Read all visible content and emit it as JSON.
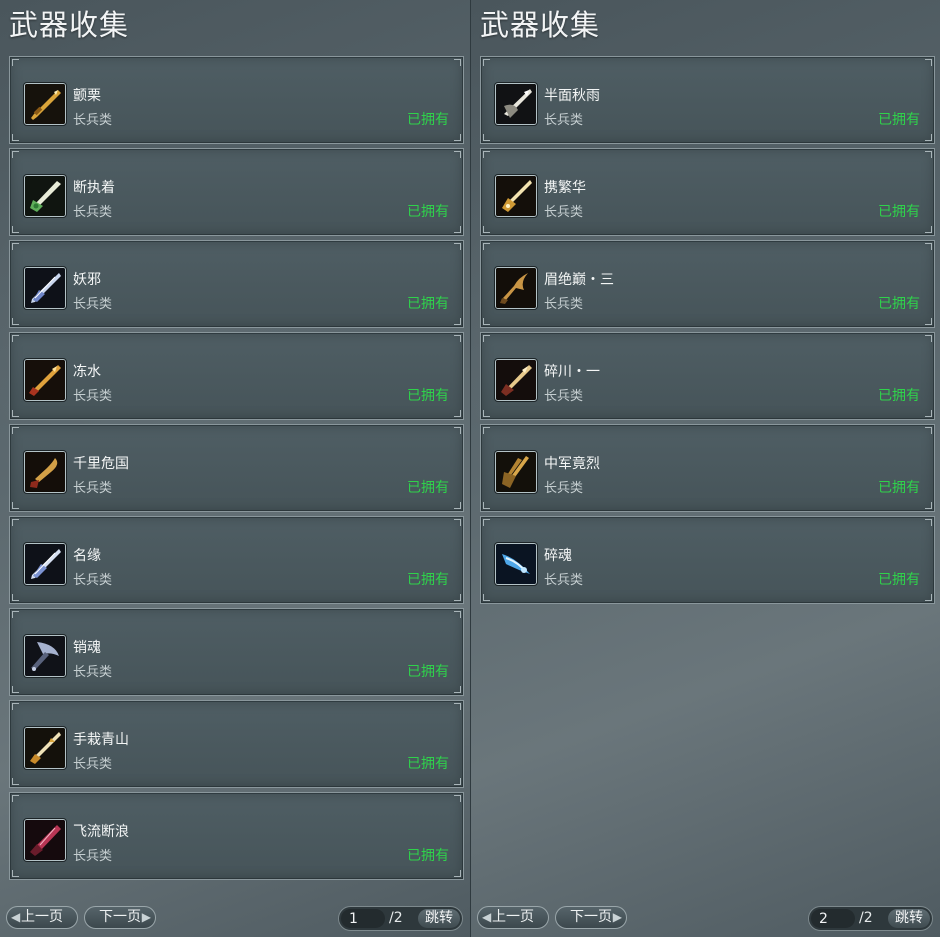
{
  "panels": [
    {
      "title": "武器收集",
      "items": [
        {
          "name": "颤栗",
          "type": "长兵类",
          "status": "已拥有",
          "icon": "golden-spear-icon"
        },
        {
          "name": "断执着",
          "type": "长兵类",
          "status": "已拥有",
          "icon": "jade-spear-icon"
        },
        {
          "name": "妖邪",
          "type": "长兵类",
          "status": "已拥有",
          "icon": "silver-spear-icon"
        },
        {
          "name": "冻水",
          "type": "长兵类",
          "status": "已拥有",
          "icon": "golden-spear-icon"
        },
        {
          "name": "千里危国",
          "type": "长兵类",
          "status": "已拥有",
          "icon": "bronze-spear-icon"
        },
        {
          "name": "名缘",
          "type": "长兵类",
          "status": "已拥有",
          "icon": "silver-spear-icon"
        },
        {
          "name": "销魂",
          "type": "长兵类",
          "status": "已拥有",
          "icon": "steel-halberd-icon"
        },
        {
          "name": "手栽青山",
          "type": "长兵类",
          "status": "已拥有",
          "icon": "golden-spear-icon"
        },
        {
          "name": "飞流断浪",
          "type": "长兵类",
          "status": "已拥有",
          "icon": "crimson-spear-icon"
        }
      ],
      "pager": {
        "prev_label": "上一页",
        "next_label": "下一页",
        "page": "1",
        "total": "/2",
        "jump_label": "跳转"
      }
    },
    {
      "title": "武器收集",
      "items": [
        {
          "name": "半面秋雨",
          "type": "长兵类",
          "status": "已拥有",
          "icon": "silver-spear-icon"
        },
        {
          "name": "携繁华",
          "type": "长兵类",
          "status": "已拥有",
          "icon": "golden-spear-icon"
        },
        {
          "name": "眉绝巅・三",
          "type": "长兵类",
          "status": "已拥有",
          "icon": "bronze-spear-icon"
        },
        {
          "name": "碎川・一",
          "type": "长兵类",
          "status": "已拥有",
          "icon": "golden-spear-icon"
        },
        {
          "name": "中军竟烈",
          "type": "长兵类",
          "status": "已拥有",
          "icon": "golden-halberd-icon"
        },
        {
          "name": "碎魂",
          "type": "长兵类",
          "status": "已拥有",
          "icon": "ice-spear-icon"
        }
      ],
      "pager": {
        "prev_label": "上一页",
        "next_label": "下一页",
        "page": "2",
        "total": "/2",
        "jump_label": "跳转"
      }
    }
  ],
  "colors": {
    "owned_status": "#2fd24b",
    "card_border": "#8a979c",
    "panel_bg": "#5a676d"
  }
}
